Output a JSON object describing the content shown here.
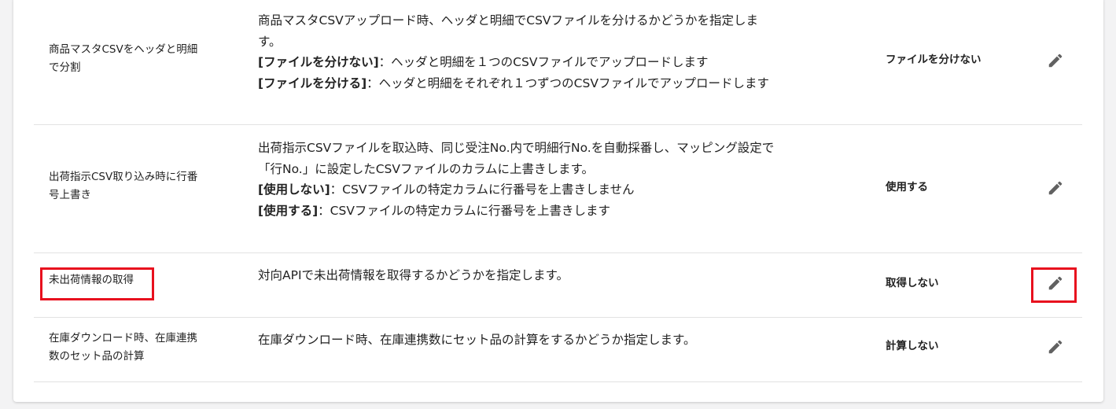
{
  "settings": [
    {
      "name_lines": [
        "商品マスタCSVをヘッダと明細",
        "で分割"
      ],
      "desc_lines": [
        {
          "bold": "",
          "text": "商品マスタCSVアップロード時、ヘッダと明細でCSVファイルを分けるかどうかを指定しま"
        },
        {
          "bold": "",
          "text": "す。"
        },
        {
          "bold": "[ファイルを分けない]",
          "text": "：ヘッダと明細を１つのCSVファイルでアップロードします"
        },
        {
          "bold": "[ファイルを分ける]",
          "text": "：ヘッダと明細をそれぞれ１つずつのCSVファイルでアップロードします"
        }
      ],
      "value": "ファイルを分けない",
      "edit_icon": "pencil-icon"
    },
    {
      "name_lines": [
        "出荷指示CSV取り込み時に行番",
        "号上書き"
      ],
      "desc_lines": [
        {
          "bold": "",
          "text": "出荷指示CSVファイルを取込時、同じ受注No.内で明細行No.を自動採番し、マッピング設定で"
        },
        {
          "bold": "",
          "text": "「行No.」に設定したCSVファイルのカラムに上書きします。"
        },
        {
          "bold": "[使用しない]",
          "text": "：CSVファイルの特定カラムに行番号を上書きしません"
        },
        {
          "bold": "[使用する]",
          "text": "：CSVファイルの特定カラムに行番号を上書きします"
        }
      ],
      "value": "使用する",
      "edit_icon": "pencil-icon"
    },
    {
      "name_lines": [
        "未出荷情報の取得"
      ],
      "desc_lines": [
        {
          "bold": "",
          "text": "対向APIで未出荷情報を取得するかどうかを指定します。"
        }
      ],
      "value": "取得しない",
      "edit_icon": "pencil-icon"
    },
    {
      "name_lines": [
        "在庫ダウンロード時、在庫連携",
        "数のセット品の計算"
      ],
      "desc_lines": [
        {
          "bold": "",
          "text": "在庫ダウンロード時、在庫連携数にセット品の計算をするかどうか指定します。"
        }
      ],
      "value": "計算しない",
      "edit_icon": "pencil-icon"
    }
  ],
  "colors": {
    "highlight": "#e8101e",
    "icon": "#616161",
    "divider": "#e2e2e2"
  }
}
